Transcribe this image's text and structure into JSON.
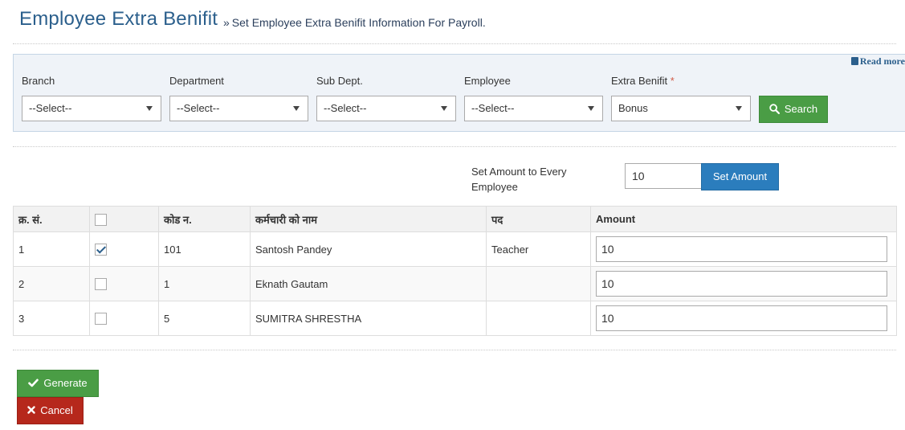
{
  "header": {
    "title": "Employee Extra Benifit",
    "subtitle_marker": "»",
    "subtitle": "Set Employee Extra Benifit Information For Payroll."
  },
  "filter": {
    "read_more": "Read more",
    "branch": {
      "label": "Branch",
      "value": "--Select--"
    },
    "department": {
      "label": "Department",
      "value": "--Select--"
    },
    "sub_dept": {
      "label": "Sub Dept.",
      "value": "--Select--"
    },
    "employee": {
      "label": "Employee",
      "value": "--Select--"
    },
    "extra_benifit": {
      "label": "Extra Benifit",
      "required_mark": "*",
      "value": "Bonus"
    },
    "search_label": "Search"
  },
  "set_amount": {
    "label": "Set Amount to Every Employee",
    "value": "10",
    "button_label": "Set Amount"
  },
  "table": {
    "headers": {
      "serial": "क्र. सं.",
      "code": "कोड न.",
      "name": "कर्मचारी को नाम",
      "post": "पद",
      "amount": "Amount"
    },
    "rows": [
      {
        "serial": "1",
        "checked": true,
        "code": "101",
        "name": "Santosh Pandey",
        "post": "Teacher",
        "amount": "10"
      },
      {
        "serial": "2",
        "checked": false,
        "code": "1",
        "name": "Eknath Gautam",
        "post": "",
        "amount": "10"
      },
      {
        "serial": "3",
        "checked": false,
        "code": "5",
        "name": "SUMITRA SHRESTHA",
        "post": "",
        "amount": "10"
      }
    ]
  },
  "actions": {
    "generate_label": "Generate",
    "cancel_label": "Cancel"
  },
  "icons": {
    "search": "search-icon",
    "check": "check-icon",
    "close": "close-icon",
    "book": "book-icon"
  },
  "colors": {
    "title": "#2b5f8c",
    "success": "#4a9d45",
    "primary": "#2b7dbd",
    "danger": "#b6281c",
    "panel_bg": "#eff3f8"
  }
}
